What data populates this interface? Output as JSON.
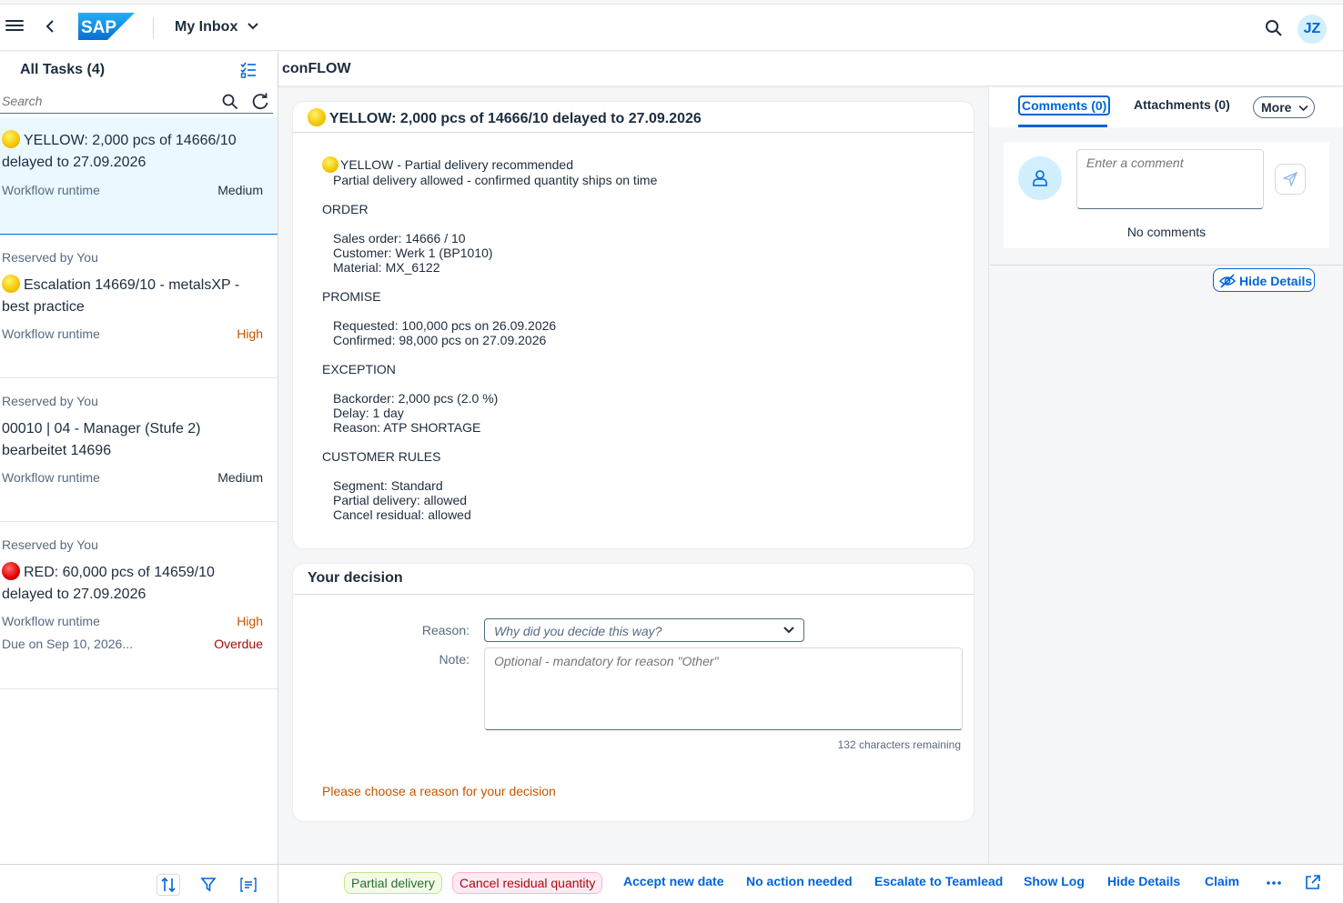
{
  "shell": {
    "app_title": "My Inbox",
    "logo_text": "SAP",
    "user_initials": "JZ"
  },
  "master": {
    "title": "All Tasks (4)",
    "search_placeholder": "Search",
    "tasks": [
      {
        "reserved": "",
        "status": "yellow",
        "title": "YELLOW: 2,000 pcs of 14666/10 delayed to 27.09.2026",
        "created_by": "Workflow runtime",
        "priority": "Medium",
        "due": "",
        "due_state": ""
      },
      {
        "reserved": "Reserved by You",
        "status": "yellow",
        "title": "Escalation 14669/10 - metalsXP - best practice",
        "created_by": "Workflow runtime",
        "priority": "High",
        "due": "",
        "due_state": ""
      },
      {
        "reserved": "Reserved by You",
        "status": "none",
        "title": "00010 | 04 - Manager (Stufe 2) bearbeitet 14696",
        "created_by": "Workflow runtime",
        "priority": "Medium",
        "due": "",
        "due_state": ""
      },
      {
        "reserved": "Reserved by You",
        "status": "red",
        "title": "RED: 60,000 pcs of 14659/10 delayed to 27.09.2026",
        "created_by": "Workflow runtime",
        "priority": "High",
        "due": "Due on Sep 10, 2026...",
        "due_state": "Overdue"
      }
    ]
  },
  "detail": {
    "header_title": "conFLOW",
    "task_card": {
      "title": "YELLOW: 2,000 pcs of 14666/10 delayed to 27.09.2026",
      "recommendation": "YELLOW - Partial delivery recommended",
      "recommendation_sub": "Partial delivery allowed - confirmed quantity ships on time",
      "sections": [
        {
          "heading": "ORDER",
          "lines": [
            "Sales order: 14666 / 10",
            "Customer: Werk 1 (BP1010)",
            "Material: MX_6122"
          ]
        },
        {
          "heading": "PROMISE",
          "lines": [
            "Requested: 100,000 pcs on 26.09.2026",
            "Confirmed: 98,000 pcs on 27.09.2026"
          ]
        },
        {
          "heading": "EXCEPTION",
          "lines": [
            "Backorder: 2,000 pcs (2.0 %)",
            "Delay: 1 day",
            "Reason: ATP SHORTAGE"
          ]
        },
        {
          "heading": "CUSTOMER RULES",
          "lines": [
            "Segment: Standard",
            "Partial delivery: allowed",
            "Cancel residual: allowed"
          ]
        }
      ]
    },
    "decision_card": {
      "title": "Your decision",
      "reason_label": "Reason:",
      "reason_placeholder": "Why did you decide this way?",
      "note_label": "Note:",
      "note_placeholder": "Optional - mandatory for reason \"Other\"",
      "remaining": "132 characters remaining",
      "warning": "Please choose a reason for your decision"
    }
  },
  "side": {
    "tab_comments": "Comments (0)",
    "tab_attachments": "Attachments (0)",
    "more": "More",
    "comment_placeholder": "Enter a comment",
    "no_comments": "No comments",
    "hide_details": "Hide Details"
  },
  "toolbar": {
    "partial_delivery": "Partial delivery",
    "cancel_residual": "Cancel residual quantity",
    "accept_new_date": "Accept new date",
    "no_action": "No action needed",
    "escalate": "Escalate to Teamlead",
    "show_log": "Show Log",
    "hide_details": "Hide Details",
    "claim": "Claim"
  },
  "colors": {
    "brand_blue": "#0064d9",
    "status_yellow": "#f5c400",
    "status_red": "#e00000",
    "priority_high": "#c35500",
    "overdue": "#aa0808"
  }
}
